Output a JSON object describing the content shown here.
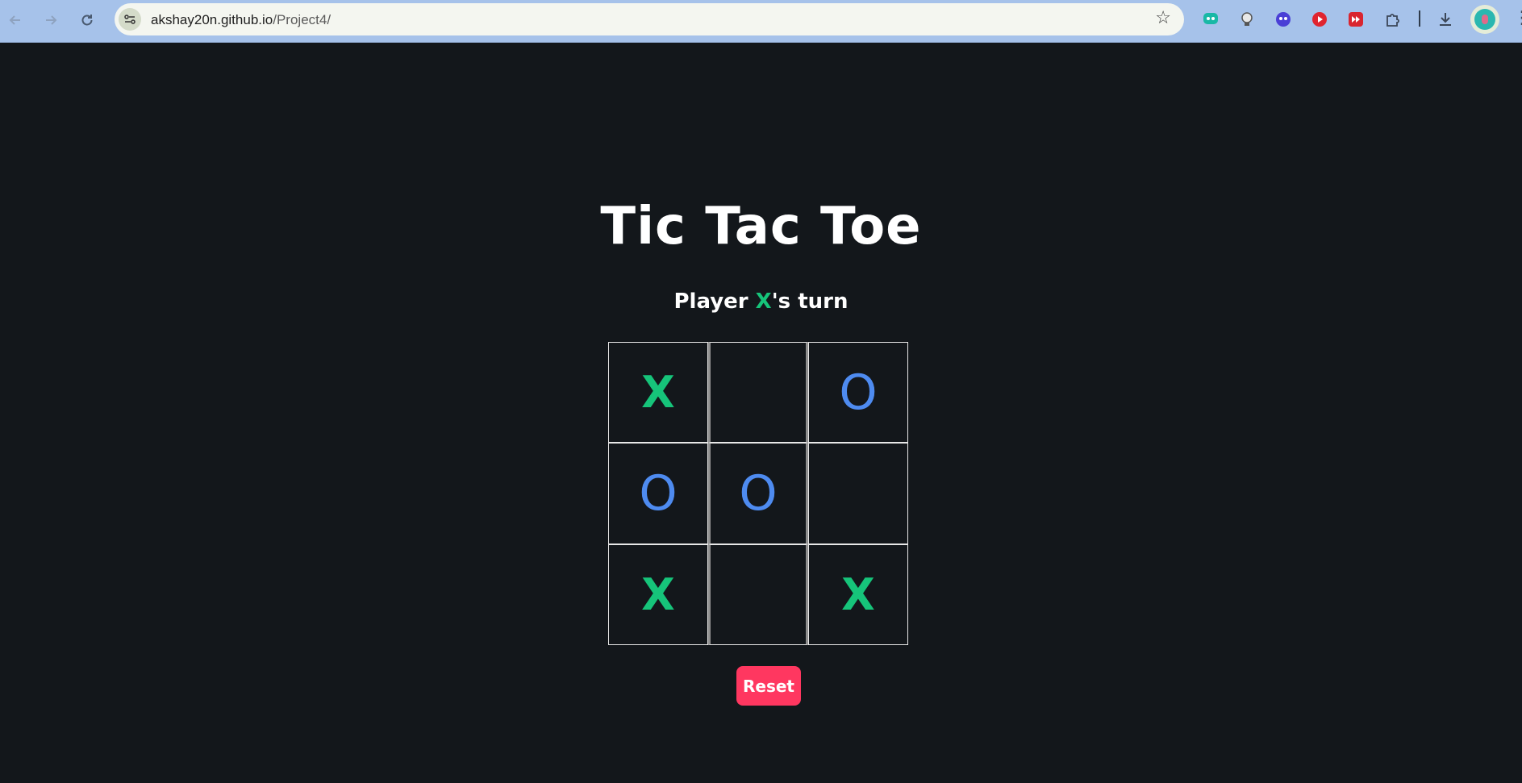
{
  "browser": {
    "url_host": "akshay20n.github.io",
    "url_path": "/Project4/",
    "back_icon": "arrow-left-icon",
    "forward_icon": "arrow-right-icon",
    "reload_icon": "reload-icon",
    "bookmark_icon": "star-icon",
    "extensions": [
      "chat-extension-icon",
      "lightbulb-extension-icon",
      "face-extension-icon",
      "play-extension-icon",
      "fast-forward-extension-icon",
      "puzzle-icon"
    ],
    "download_icon": "download-icon",
    "menu_icon": "kebab-menu-icon"
  },
  "game": {
    "title": "Tic Tac Toe",
    "turn_prefix": "Player ",
    "turn_mark": "X",
    "turn_suffix": "'s turn",
    "board": [
      "X",
      "",
      "O",
      "O",
      "O",
      "",
      "X",
      "",
      "X"
    ],
    "reset_label": "Reset",
    "colors": {
      "x": "#16c47a",
      "o": "#4e8bf0",
      "reset": "#ff3760",
      "background": "#13171b"
    }
  }
}
